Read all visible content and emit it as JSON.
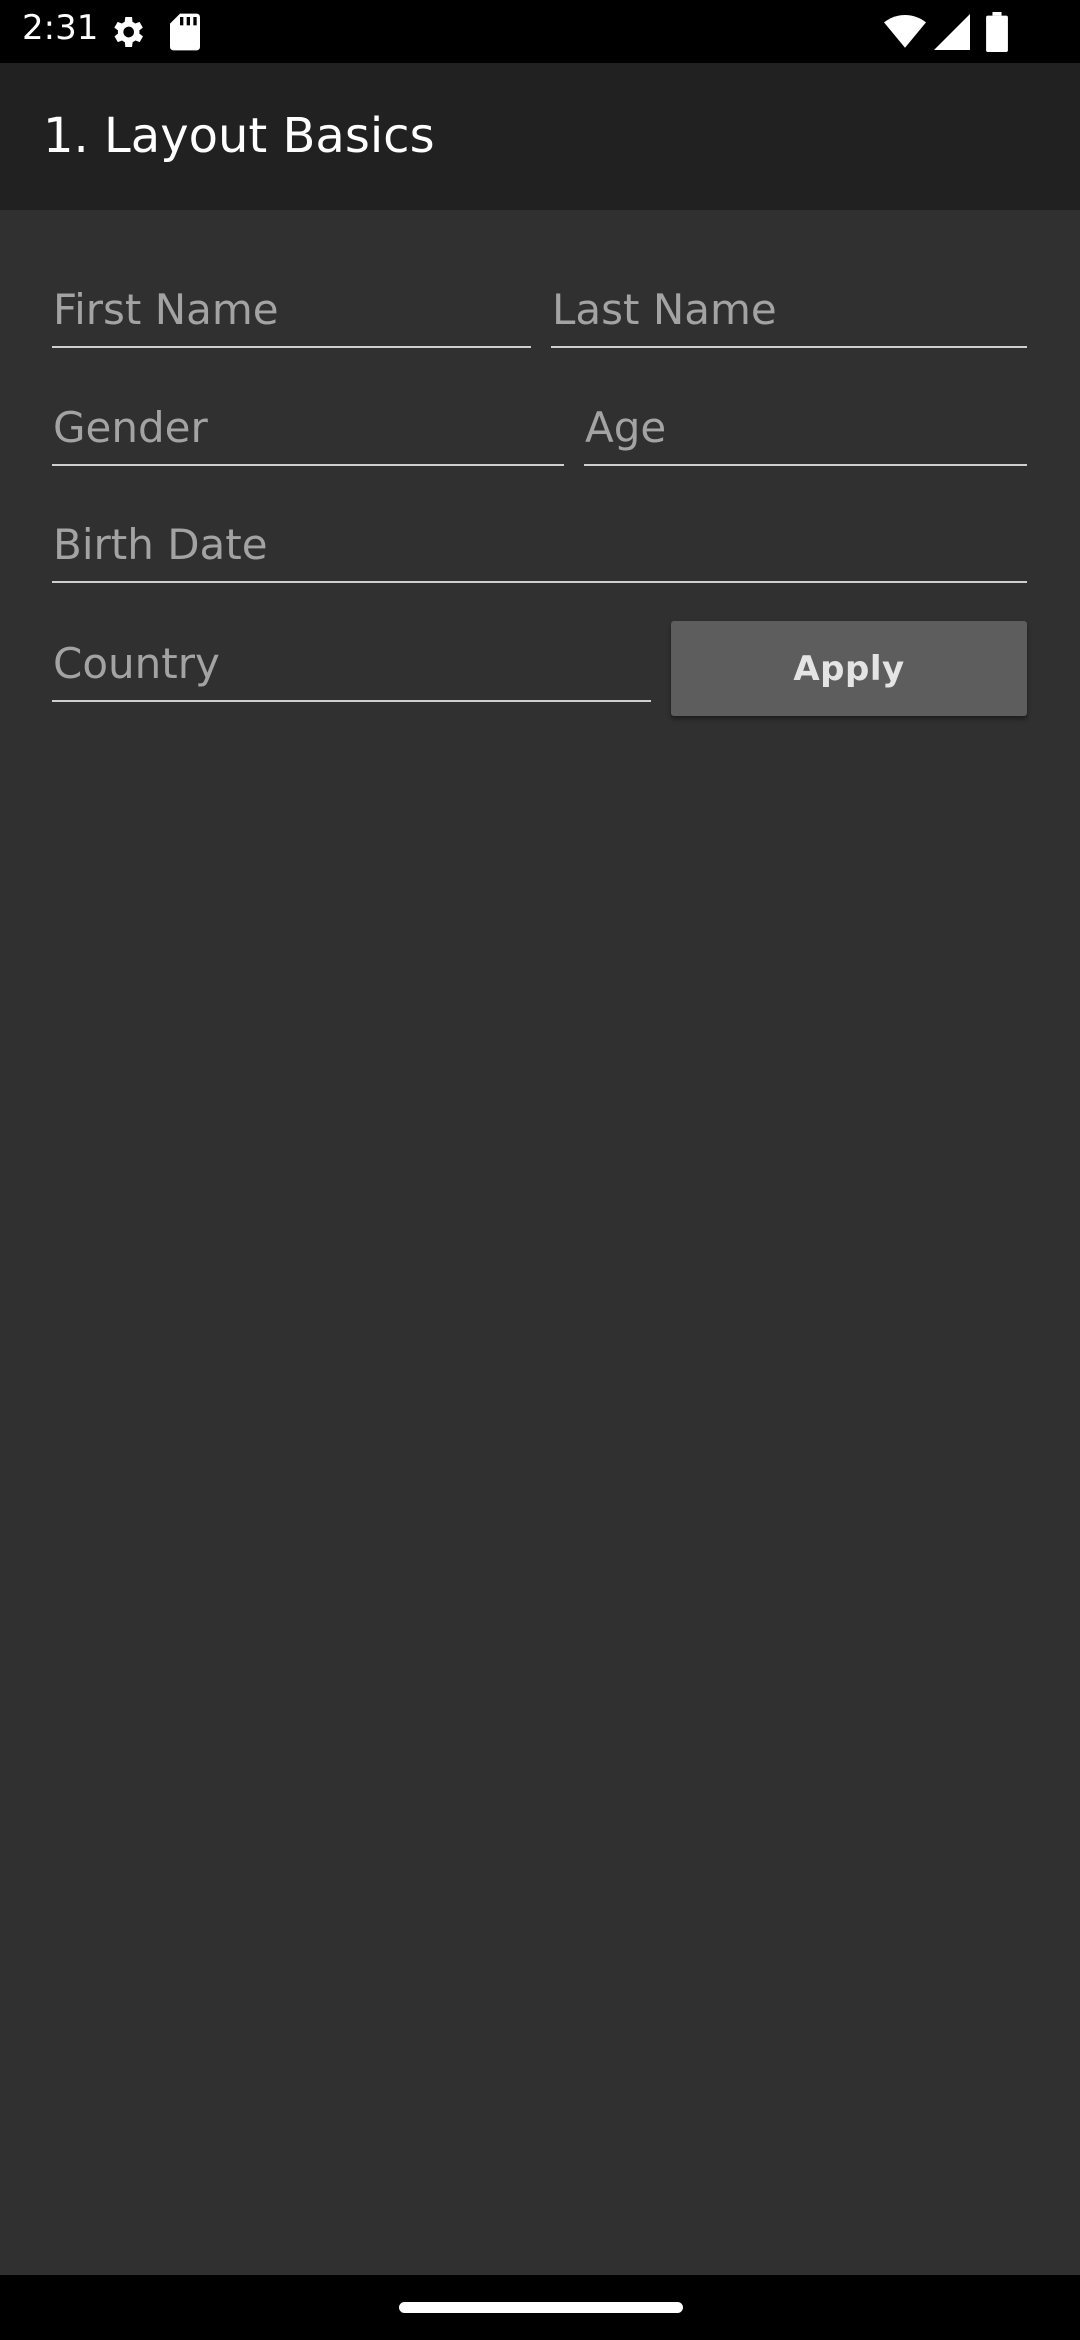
{
  "status_bar": {
    "time": "2:31",
    "icons": [
      "settings-gear-icon",
      "sd-card-icon",
      "wifi-icon",
      "cellular-signal-icon",
      "battery-icon"
    ]
  },
  "app_bar": {
    "title": "1. Layout Basics"
  },
  "form": {
    "first_name": {
      "value": "",
      "placeholder": "First Name"
    },
    "last_name": {
      "value": "",
      "placeholder": "Last Name"
    },
    "gender": {
      "value": "",
      "placeholder": "Gender"
    },
    "age": {
      "value": "",
      "placeholder": "Age"
    },
    "birth_date": {
      "value": "",
      "placeholder": "Birth Date"
    },
    "country": {
      "value": "",
      "placeholder": "Country"
    },
    "apply_label": "Apply"
  },
  "colors": {
    "background": "#303030",
    "app_bar": "#212121",
    "button": "#5d5d5d",
    "placeholder": "#a3a3a3"
  }
}
